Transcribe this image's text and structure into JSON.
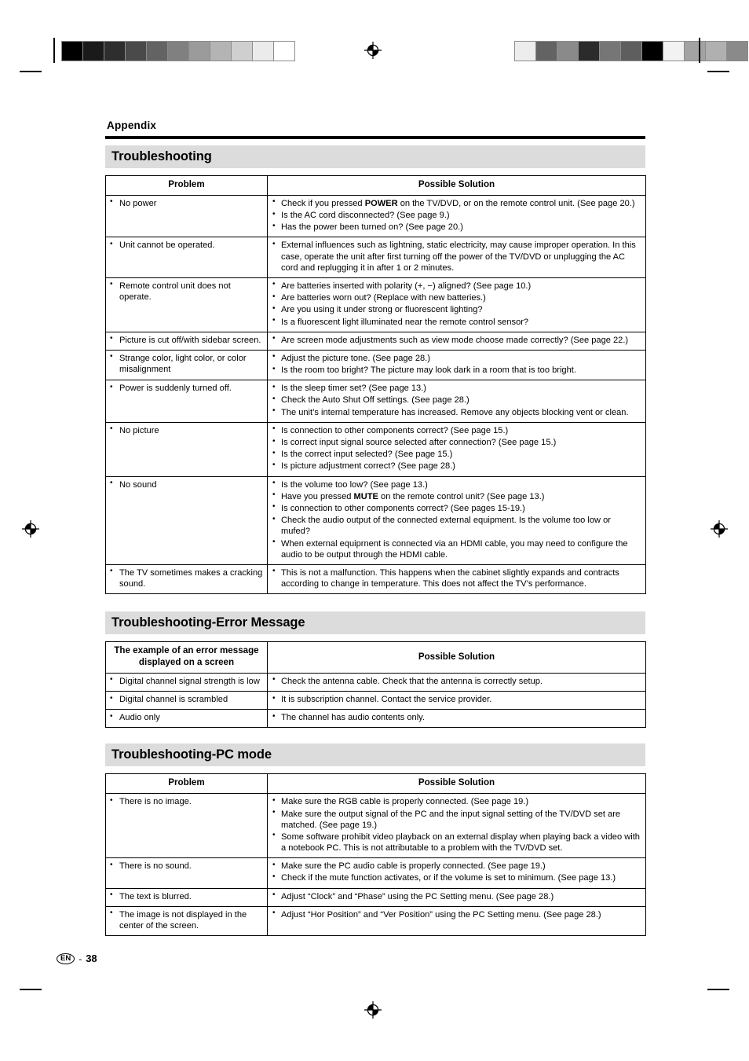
{
  "page": {
    "appendix_label": "Appendix",
    "footer": {
      "language_code": "EN",
      "dash": "-",
      "page_number": "38"
    }
  },
  "print_marks": {
    "left_gradient_bar": [
      "#000000",
      "#1a1a1a",
      "#2e2e2e",
      "#4a4a4a",
      "#636363",
      "#808080",
      "#9b9b9b",
      "#b4b4b4",
      "#cfcfcf",
      "#ebebeb",
      "#ffffff"
    ],
    "right_gradient_bar": [
      "#ededed",
      "#636363",
      "#8a8a8a",
      "#2b2b2b",
      "#767676",
      "#5e5e5e",
      "#000000",
      "#f2f2f2",
      "#a3a3a3",
      "#b0b0b0",
      "#8a8a8a"
    ],
    "registration_icon": "registration-target-icon"
  },
  "sections": [
    {
      "title": "Troubleshooting",
      "table": {
        "headers": [
          "Problem",
          "Possible Solution"
        ],
        "rows": [
          {
            "problem": [
              "No power"
            ],
            "solution": [
              "Check if you pressed POWER on the TV/DVD, or on the remote control unit. (See page 20.)",
              "Is the AC cord disconnected? (See page 9.)",
              "Has the power been turned on? (See page 20.)"
            ]
          },
          {
            "problem": [
              "Unit cannot be operated."
            ],
            "solution": [
              "External influences such as lightning, static electricity, may cause improper operation. In this case, operate the unit after first turning off the power of the TV/DVD or unplugging the AC cord and replugging it in after 1 or 2 minutes."
            ]
          },
          {
            "problem": [
              "Remote control unit does not operate."
            ],
            "solution": [
              "Are batteries inserted with polarity (+, −) aligned? (See page 10.)",
              "Are batteries worn out? (Replace with new batteries.)",
              "Are you using it under strong or fluorescent lighting?",
              "Is a fluorescent light illuminated near the remote control sensor?"
            ]
          },
          {
            "problem": [
              "Picture is cut off/with sidebar screen."
            ],
            "solution": [
              "Are screen mode adjustments such as view mode choose made correctly? (See page 22.)"
            ]
          },
          {
            "problem": [
              "Strange color, light color, or color misalignment"
            ],
            "solution": [
              "Adjust the picture tone. (See page 28.)",
              "Is the room too bright? The picture may look dark in a room that is too bright."
            ]
          },
          {
            "problem": [
              "Power is suddenly turned off."
            ],
            "solution": [
              "Is the sleep timer set? (See page 13.)",
              "Check the Auto Shut Off settings. (See page 28.)",
              "The unit’s internal temperature has increased. Remove any objects blocking vent or clean."
            ]
          },
          {
            "problem": [
              "No picture"
            ],
            "solution": [
              "Is connection to other components correct? (See page 15.)",
              "Is correct input signal source selected after connection? (See page 15.)",
              "Is the correct input selected? (See page 15.)",
              "Is picture adjustment correct? (See page 28.)"
            ]
          },
          {
            "problem": [
              "No sound"
            ],
            "solution": [
              "Is the volume too low? (See page 13.)",
              "Have you pressed MUTE on the remote control unit? (See page 13.)",
              "Is connection to other components correct? (See pages 15-19.)",
              "Check the audio output of the connected external equipment. Is the volume too low or mufed?",
              "When external equiprnent is connected via an HDMI cable, you may need to configure the audio to be output through the HDMI cable."
            ]
          },
          {
            "problem": [
              "The TV sometimes makes a cracking sound."
            ],
            "solution": [
              "This is not a malfunction. This happens when the cabinet slightly expands and contracts according to change in temperature. This does not affect the TV’s performance."
            ]
          }
        ]
      }
    },
    {
      "title": "Troubleshooting-Error Message",
      "table": {
        "headers": [
          "The example of an error message displayed on a screen",
          "Possible Solution"
        ],
        "rows": [
          {
            "problem": [
              "Digital channel signal strength is low"
            ],
            "solution": [
              "Check the antenna cable. Check that the antenna is correctly setup."
            ]
          },
          {
            "problem": [
              "Digital channel is scrambled"
            ],
            "solution": [
              "It is subscription channel. Contact the service provider."
            ]
          },
          {
            "problem": [
              "Audio only"
            ],
            "solution": [
              "The channel has audio contents only."
            ]
          }
        ]
      }
    },
    {
      "title": "Troubleshooting-PC mode",
      "table": {
        "headers": [
          "Problem",
          "Possible Solution"
        ],
        "rows": [
          {
            "problem": [
              "There is no image."
            ],
            "solution": [
              "Make sure the RGB cable is properly connected. (See page 19.)",
              "Make sure the output signal of the PC and the input signal setting of the TV/DVD set are matched. (See page 19.)",
              "Some software prohibit video playback on an external display when playing back a video with a notebook PC. This is not attributable to a problem with the TV/DVD set."
            ]
          },
          {
            "problem": [
              "There is no sound."
            ],
            "solution": [
              "Make sure the PC audio cable is properly connected. (See page 19.)",
              "Check if the mute function activates, or if the volume is set to minimum. (See page 13.)"
            ]
          },
          {
            "problem": [
              "The text is blurred."
            ],
            "solution": [
              "Adjust “Clock” and “Phase” using the PC Setting menu. (See page 28.)"
            ]
          },
          {
            "problem": [
              "The image is not displayed in the center of the screen."
            ],
            "solution": [
              "Adjust “Hor Position” and “Ver Position” using the PC Setting menu. (See page 28.)"
            ]
          }
        ]
      }
    }
  ],
  "bold_terms": [
    "POWER",
    "MUTE"
  ]
}
